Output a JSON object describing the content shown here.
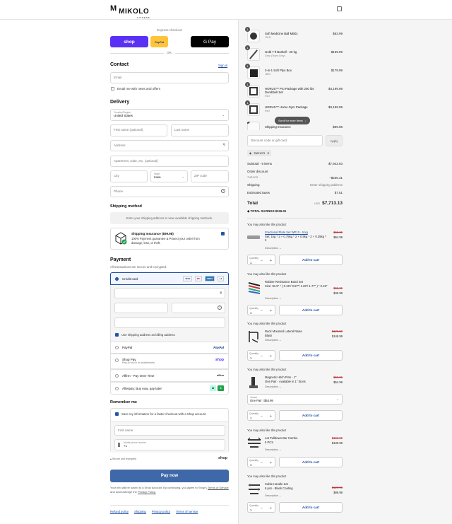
{
  "header": {
    "brand": "MIKOLO",
    "brand_sub": "FITNESS",
    "logo_mark": "M"
  },
  "express": {
    "label": "Express checkout",
    "shop_label": "shop",
    "paypal_label": "PayPal",
    "gpay_label": "G Pay",
    "or_label": "OR"
  },
  "contact": {
    "title": "Contact",
    "signin": "Sign in",
    "email_placeholder": "Email",
    "news_label": "Email me with news and offers"
  },
  "delivery": {
    "title": "Delivery",
    "country_label": "Country/Region",
    "country_value": "United States",
    "first_name": "First name (optional)",
    "last_name": "Last name",
    "address": "Address",
    "apartment": "Apartment, suite, etc. (optional)",
    "city": "City",
    "state_label": "State",
    "state_value": "Iowa",
    "zip": "ZIP code",
    "phone": "Phone"
  },
  "shipping_method": {
    "title": "Shipping method",
    "notice": "Enter your shipping address to view available shipping methods."
  },
  "insurance": {
    "title": "Shipping Insurance ($99.98)",
    "text": "100% Payment guarantee & Protect your order from damage, loss, or theft."
  },
  "payment": {
    "title": "Payment",
    "subtitle": "All transactions are secure and encrypted.",
    "credit_card": "Credit card",
    "card_brands": [
      "VISA",
      "MC",
      "AMEX",
      "+1"
    ],
    "billing_label": "Use shipping address as billing address",
    "paypal": "PayPal",
    "paypal_logo": "PayPal",
    "shoppay": "Shop Pay",
    "shoppay_sub": "Pay in full or in installments",
    "shoppay_logo": "shop",
    "affirm": "Affirm - Pay Over Time",
    "affirm_logo": "affirm",
    "afterpay": "Afterpay: Buy now, pay later"
  },
  "remember": {
    "title": "Remember me",
    "save_label": "Save my information for a faster checkout with a Shop account",
    "first_name": "First name",
    "mobile_label": "Mobile phone number",
    "mobile_value": "+1",
    "secure": "Secure and encrypted",
    "shop_logo": "shop"
  },
  "pay_now": "Pay now",
  "legal": {
    "text": "Your info will be saved to a Shop account. By continuing, you agree to Shop's",
    "terms": "Terms of Service",
    "and": "and acknowledge the",
    "privacy": "Privacy Policy."
  },
  "footer_links": [
    "Refund policy",
    "Shipping",
    "Privacy policy",
    "Terms of service"
  ],
  "cart": {
    "items": [
      {
        "qty": "1",
        "name": "Soft Medicine Ball MB01",
        "variant": "15LB",
        "price": "$63.99"
      },
      {
        "qty": "1",
        "name": "Gold 7 ft Barbell - 20 kg",
        "variant": "Grey (Team Grey)",
        "price": "$199.99"
      },
      {
        "qty": "1",
        "name": "3-in-1 Soft Plyo Box",
        "variant": "JB02",
        "price": "$179.99"
      },
      {
        "qty": "1",
        "name": "HORUS™ Pro Package with 200 lbs Dumbbell Set",
        "variant": "Red",
        "price": "$4,199.99"
      },
      {
        "qty": "1",
        "name": "HORUS™ Home Gym Package",
        "variant": "Red",
        "price": "$3,199.99"
      },
      {
        "qty": "1",
        "name": "Shipping Insurance",
        "variant": "",
        "price": "$99.98"
      }
    ],
    "scroll_hint": "Scroll for more items",
    "discount_placeholder": "Discount code or gift card",
    "apply": "Apply",
    "code_tag": "7NR1CR",
    "subtotal_label": "Subtotal · 6 items",
    "subtotal": "$7,943.93",
    "order_discount_label": "Order discount",
    "discount_code": "7NR1CR",
    "discount_amount": "−$236.31",
    "shipping_label": "Shipping",
    "shipping_value": "Enter shipping address",
    "taxes_label": "Estimated taxes",
    "taxes_value": "$7.51",
    "total_label": "Total",
    "currency": "USD",
    "total": "$7,713.13",
    "savings_label": "TOTAL SAVINGS",
    "savings": "$236.31"
  },
  "upsell": {
    "heading": "You may also like this product",
    "qty_label": "Quantity",
    "qty_value": "1",
    "add": "Add to cart",
    "desc": "Description",
    "variant_label": "Variant",
    "products": [
      {
        "name": "Fractional Plate Set WP10 - 5 kg",
        "detail": "Set: 1kg * 2 + 0.75kg * 2 + 0.5kg * 2 + 0.25kg * 2",
        "old": "$69.99",
        "new": "$64.99"
      },
      {
        "name": "Rubber Resistance Band Set",
        "detail": "Size: 81.9\" * ( 0.15\"/ 0.87\"/ 1.26\"/ 1.77\" ) * 0.18\"",
        "old": "$69.99",
        "new": "$49.99"
      },
      {
        "name": "Rack Mounted Lateral Raise",
        "detail": "Black",
        "old": "$179.99",
        "new": "$149.99"
      },
      {
        "name": "Magnetic Hitch Pins - 1\"",
        "detail": "One Pair - Available in 1\" Sizes",
        "old": "$69.99",
        "new": "$54.99",
        "variant": "One Pair | $54.99"
      },
      {
        "name": "Lat Pulldown Bar Combo",
        "detail": "5 PCS",
        "old": "$169.99",
        "new": "$139.99"
      },
      {
        "name": "Cable Handle Set",
        "detail": "6 pcs - Black Coating",
        "old": "$129.99",
        "new": "$99.99"
      }
    ]
  },
  "colors": {
    "accent": "#1c4ea5",
    "shop_purple": "#5a31f4",
    "paypal_yellow": "#ffc439",
    "pay_button": "#3f68a8"
  }
}
